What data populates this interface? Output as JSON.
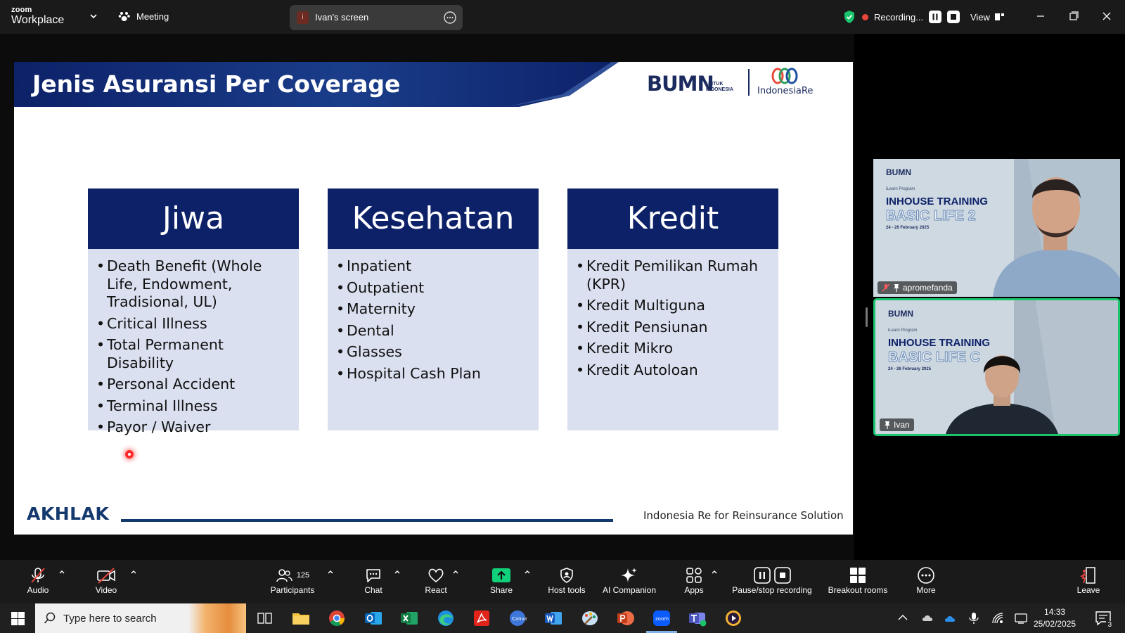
{
  "app": {
    "brand_small": "zoom",
    "brand_large": "Workplace",
    "meeting_label": "Meeting",
    "share_indicator_letter": "i",
    "share_label": "Ivan's screen",
    "recording_label": "Recording...",
    "view_label": "View"
  },
  "slide": {
    "title": "Jenis Asuransi Per Coverage",
    "logo_bumn": "BUMN",
    "logo_bumn_sub_1": "UNTUK",
    "logo_bumn_sub_2": "INDONESIA",
    "logo_ire": "IndonesiaRe",
    "columns": [
      {
        "heading": "Jiwa",
        "items": [
          "Death Benefit (Whole Life, Endowment, Tradisional, UL)",
          "Critical Illness",
          "Total Permanent Disability",
          "Personal Accident",
          "Terminal Illness",
          "Payor / Waiver"
        ]
      },
      {
        "heading": "Kesehatan",
        "items": [
          "Inpatient",
          "Outpatient",
          "Maternity",
          "Dental",
          "Glasses",
          "Hospital Cash Plan"
        ]
      },
      {
        "heading": "Kredit",
        "items": [
          "Kredit Pemilikan Rumah (KPR)",
          "Kredit Multiguna",
          "Kredit Pensiunan",
          "Kredit Mikro",
          "Kredit Autoloan"
        ]
      }
    ],
    "footer_logo": "AKHLAK",
    "footer_text": "Indonesia Re for Reinsurance Solution"
  },
  "participants": [
    {
      "name": "apromefanda",
      "bg_logo": "BUMN",
      "bg_program": "iLearn Program",
      "bg_training": "INHOUSE TRAINING",
      "bg_basic": "BASIC LIFE 2",
      "bg_date": "24 - 26 February 2025"
    },
    {
      "name": "Ivan",
      "bg_logo": "BUMN",
      "bg_program": "iLearn Program",
      "bg_training": "INHOUSE TRAINING",
      "bg_basic": "BASIC LIFE C",
      "bg_date": "24 - 26 February 2025"
    }
  ],
  "toolbar": {
    "audio": "Audio",
    "video": "Video",
    "participants": "Participants",
    "participants_count": "125",
    "chat": "Chat",
    "react": "React",
    "share": "Share",
    "host_tools": "Host tools",
    "ai_companion": "AI Companion",
    "apps": "Apps",
    "pause_stop": "Pause/stop recording",
    "breakout": "Breakout rooms",
    "more": "More",
    "leave": "Leave"
  },
  "taskbar": {
    "search_placeholder": "Type here to search",
    "time": "14:33",
    "date": "25/02/2025",
    "notification_count": "3"
  },
  "colors": {
    "slide_header": "#0d2168",
    "column_head": "#0d2168",
    "column_body": "#dbe0f0",
    "recording": "#e8453c",
    "active_speaker": "#19c46c",
    "share_green": "#0fd17a"
  }
}
